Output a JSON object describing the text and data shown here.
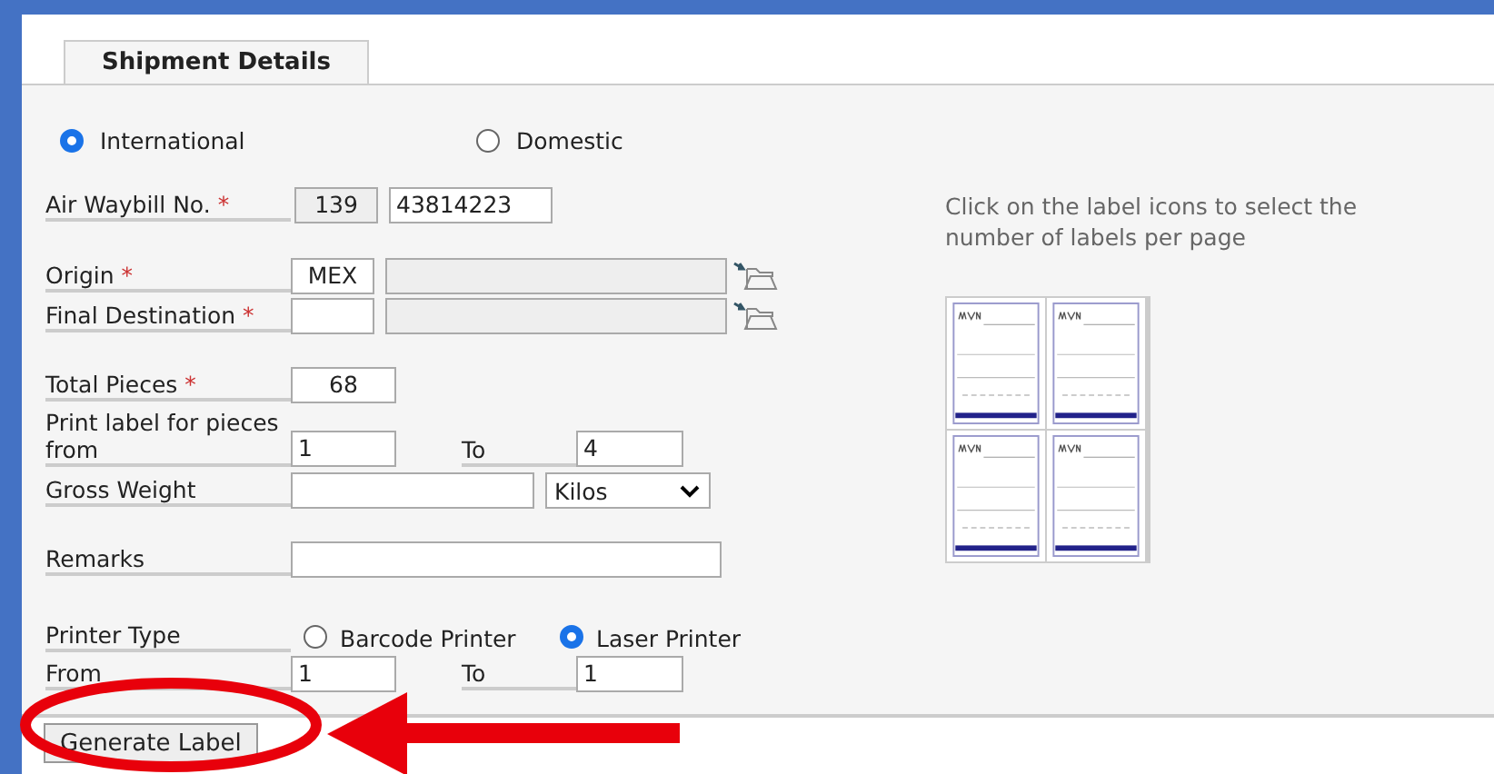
{
  "tabs": [
    {
      "label": "Shipment Details",
      "selected": true
    }
  ],
  "shipment_type": [
    {
      "label": "International",
      "selected": true
    },
    {
      "label": "Domestic",
      "selected": false
    }
  ],
  "air_waybill": {
    "label": "Air Waybill No.",
    "required_mark": "*",
    "prefix": "139",
    "number": "43814223"
  },
  "origin": {
    "label": "Origin",
    "required_mark": "*",
    "value": "MEX"
  },
  "final_destination": {
    "label": "Final Destination",
    "required_mark": "*"
  },
  "total_pieces": {
    "label": "Total Pieces",
    "required_mark": "*",
    "value": "68"
  },
  "pieces_range": {
    "label": "Print label for pieces from",
    "from": "1",
    "to_label": "To",
    "to": "4"
  },
  "gross_weight": {
    "label": "Gross Weight",
    "unit": "Kilos"
  },
  "remarks": {
    "label": "Remarks"
  },
  "printer_type": {
    "label": "Printer Type",
    "options": [
      {
        "label": "Barcode Printer",
        "selected": false
      },
      {
        "label": "Laser Printer",
        "selected": true
      }
    ]
  },
  "page_range": {
    "label": "From",
    "from": "1",
    "to_label": "To",
    "to": "1"
  },
  "hint": "Click on the label icons to select the number of labels per page",
  "generate_button": "Generate Label"
}
